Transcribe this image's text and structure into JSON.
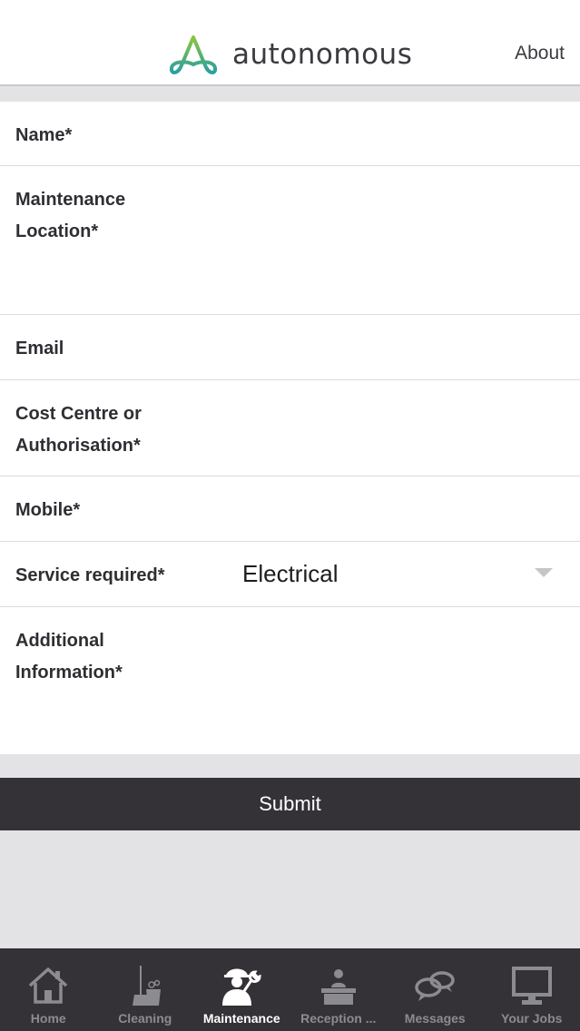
{
  "header": {
    "logo_text": "autonomous",
    "about_label": "About"
  },
  "form": {
    "name_label": "Name*",
    "location_label": "Maintenance Location*",
    "email_label": "Email",
    "cost_label": "Cost Centre or Authorisation*",
    "mobile_label": "Mobile*",
    "service_label": "Service required*",
    "service_value": "Electrical",
    "additional_label": "Additional Information*",
    "submit_label": "Submit"
  },
  "tabs": [
    {
      "label": "Home",
      "icon": "home-icon"
    },
    {
      "label": "Cleaning",
      "icon": "cleaning-icon"
    },
    {
      "label": "Maintenance",
      "icon": "maintenance-icon"
    },
    {
      "label": "Reception ...",
      "icon": "reception-icon"
    },
    {
      "label": "Messages",
      "icon": "messages-icon"
    },
    {
      "label": "Your Jobs",
      "icon": "monitor-icon"
    }
  ],
  "colors": {
    "header_bg": "#ffffff",
    "page_bg": "#e3e2e4",
    "dark_bar": "#343236",
    "tab_inactive": "#8c8b90",
    "tab_active": "#ffffff",
    "logo_teal": "#2aa59a",
    "logo_green": "#8cc63f"
  }
}
